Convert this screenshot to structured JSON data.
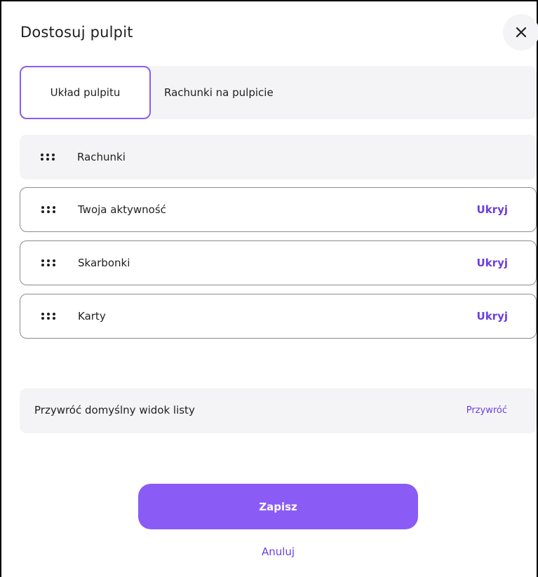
{
  "modal": {
    "title": "Dostosuj pulpit",
    "close_icon": "close-icon"
  },
  "tabs": [
    {
      "label": "Układ pulpitu",
      "active": true
    },
    {
      "label": "Rachunki na pulpicie",
      "active": false
    }
  ],
  "sections": [
    {
      "label": "Rachunki",
      "action": null,
      "icon": "drag-handle-icon"
    },
    {
      "label": "Twoja aktywność",
      "action": "Ukryj",
      "icon": "drag-handle-icon"
    },
    {
      "label": "Skarbonki",
      "action": "Ukryj",
      "icon": "drag-handle-icon"
    },
    {
      "label": "Karty",
      "action": "Ukryj",
      "icon": "drag-handle-icon"
    }
  ],
  "restore": {
    "label": "Przywróć domyślny widok listy",
    "action": "Przywróć"
  },
  "footer": {
    "save_label": "Zapisz",
    "cancel_label": "Anuluj"
  },
  "colors": {
    "accent": "#8a5cf5",
    "link": "#6b3fe0",
    "panel": "#f4f4f6"
  }
}
